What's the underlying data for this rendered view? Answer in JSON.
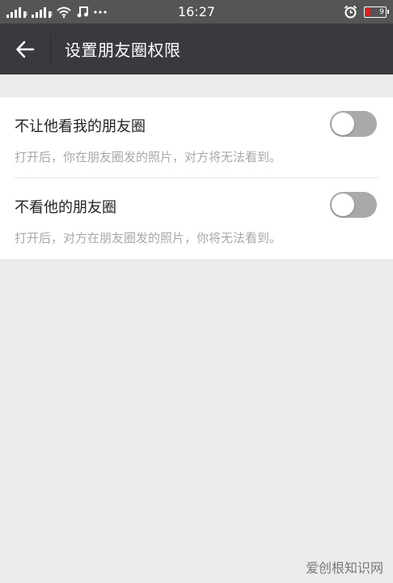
{
  "status_bar": {
    "time": "16:27",
    "signal1_label": "0",
    "signal2_label": "0",
    "battery_level": "9",
    "icons": [
      "signal-icon",
      "signal-icon",
      "wifi-icon",
      "music-note-icon",
      "more-dots-icon",
      "alarm-clock-icon",
      "battery-icon"
    ]
  },
  "header": {
    "title": "设置朋友圈权限",
    "back_icon": "arrow-left-icon"
  },
  "settings": [
    {
      "label": "不让他看我的朋友圈",
      "description": "打开后，你在朋友圈发的照片，对方将无法看到。",
      "enabled": false
    },
    {
      "label": "不看他的朋友圈",
      "description": "打开后，对方在朋友圈发的照片，你将无法看到。",
      "enabled": false
    }
  ],
  "watermark": "爱创根知识网",
  "colors": {
    "status_bar": "#555555",
    "title_bar": "#393a3f",
    "page_background": "#ebebeb",
    "toggle_off": "#a9a9a9"
  }
}
